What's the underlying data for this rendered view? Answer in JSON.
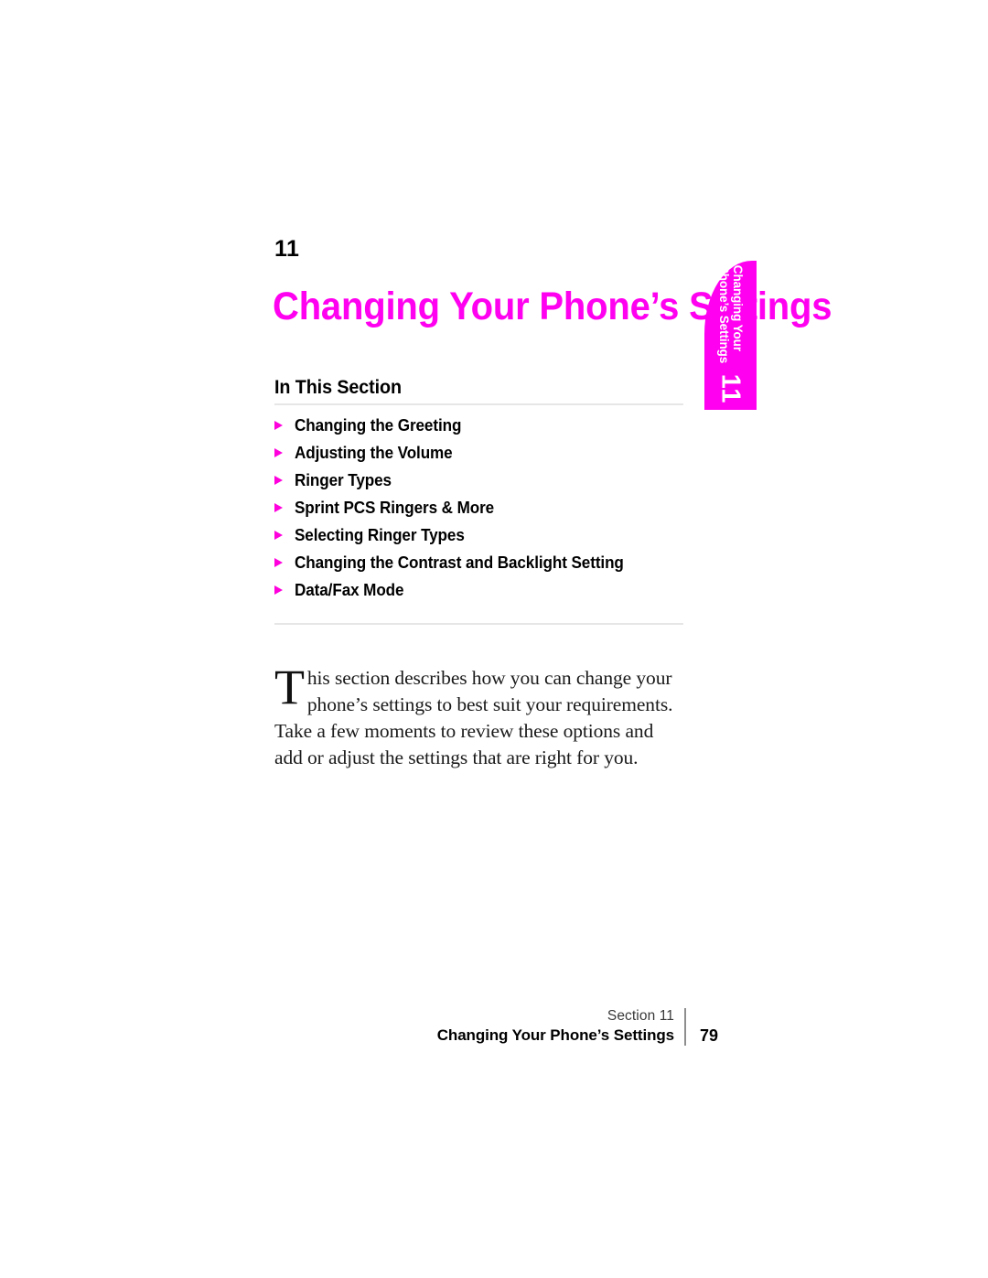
{
  "colors": {
    "accent_magenta": "#ff00f0",
    "bullet_magenta": "#ff00dd",
    "rule_gray": "#e6e6e6",
    "text_black": "#000000"
  },
  "chapter": {
    "number": "11",
    "title": "Changing Your Phone’s Settings"
  },
  "in_this_section": {
    "heading": "In This Section",
    "items": [
      {
        "label": "Changing the Greeting"
      },
      {
        "label": "Adjusting the Volume"
      },
      {
        "label": "Ringer Types"
      },
      {
        "label": "Sprint PCS Ringers & More"
      },
      {
        "label": "Selecting Ringer Types"
      },
      {
        "label": "Changing the Contrast and Backlight Setting"
      },
      {
        "label": "Data/Fax Mode"
      }
    ]
  },
  "intro": {
    "dropcap": "T",
    "body": "his section describes how you can change your phone’s settings to best suit your requirements. Take a few moments to review these options and add or adjust the settings that are right for you."
  },
  "side_tab": {
    "line1": "Changing Your",
    "line2": "Phone’s Settings",
    "number": "11"
  },
  "footer": {
    "section": "Section 11",
    "title": "Changing Your Phone’s Settings",
    "page": "79"
  }
}
